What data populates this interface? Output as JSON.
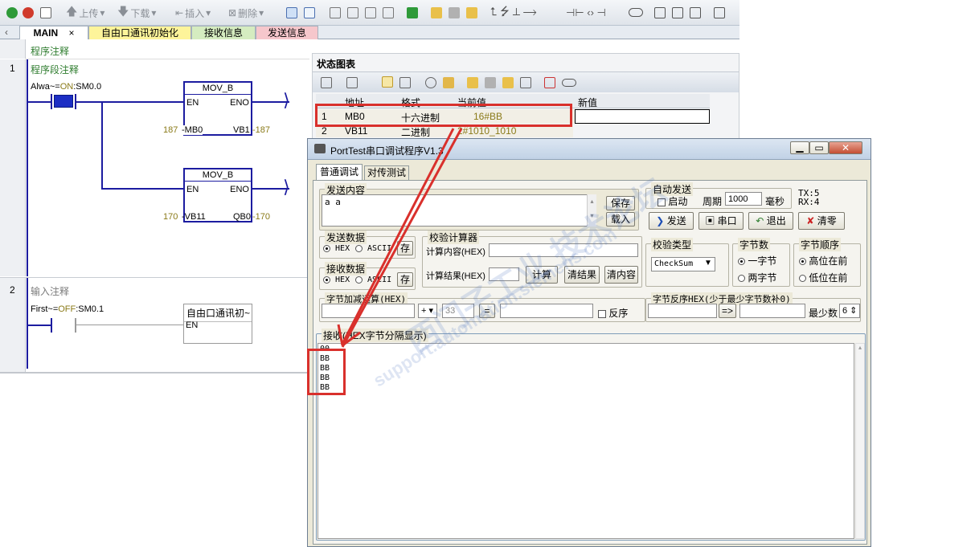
{
  "toolbar": {
    "upload": "上传",
    "download": "下载",
    "insert": "插入",
    "delete": "删除"
  },
  "tabs": [
    {
      "label": "MAIN",
      "close": "×"
    },
    {
      "label": "自由口通讯初始化"
    },
    {
      "label": "接收信息"
    },
    {
      "label": "发送信息"
    }
  ],
  "ladder": {
    "program_comment": "程序注释",
    "net1": {
      "num": "1",
      "comment": "程序段注释",
      "contact_sym": "Alwa~",
      "contact_eq": "=",
      "contact_state": "ON",
      "contact_addr": ":SM0.0",
      "box1": {
        "title": "MOV_B",
        "en": "EN",
        "eno": "ENO",
        "in_val": "187",
        "in": "MB0",
        "out": "VB1",
        "out_val": "187"
      },
      "box2": {
        "title": "MOV_B",
        "en": "EN",
        "eno": "ENO",
        "in_val": "170",
        "in": "VB11",
        "out": "QB0",
        "out_val": "170"
      }
    },
    "net2": {
      "num": "2",
      "comment": "输入注释",
      "contact_sym": "First~",
      "contact_eq": "=",
      "contact_state": "OFF",
      "contact_addr": ":SM0.1",
      "box_title": "自由口通讯初~",
      "en": "EN"
    }
  },
  "status_chart": {
    "title": "状态图表",
    "columns": [
      "",
      "地址",
      "格式",
      "当前值",
      "新值"
    ],
    "rows": [
      {
        "n": "1",
        "addr": "MB0",
        "fmt": "十六进制",
        "val": "16#BB",
        "new": ""
      },
      {
        "n": "2",
        "addr": "VB11",
        "fmt": "二进制",
        "val": "2#1010_1010",
        "new": ""
      }
    ]
  },
  "porttest": {
    "title": "PortTest串口调试程序V1.3",
    "tabs": [
      "普通调试",
      "对传测试"
    ],
    "send_content_label": "发送内容",
    "send_text": "a a",
    "save_btn": "保存",
    "load_btn": "载入",
    "auto_send_label": "自动发送",
    "start_label": "启动",
    "period_label": "周期",
    "period_value": "1000",
    "ms_label": "毫秒",
    "tx": "TX:5",
    "rx": "RX:4",
    "send_btn": "发送",
    "port_btn": "串口",
    "exit_btn": "退出",
    "clear_btn": "清零",
    "send_data_label": "发送数据",
    "hex": "HEX",
    "ascii": "ASCII",
    "store": "存",
    "recv_data_label": "接收数据",
    "calc_label": "校验计算器",
    "calc_content": "计算内容(HEX)",
    "calc_result": "计算结果(HEX)",
    "calc_btn": "计算",
    "clear_result_btn": "清结果",
    "clear_content_btn": "清内容",
    "check_type_label": "校验类型",
    "check_type_value": "CheckSum",
    "byte_count_label": "字节数",
    "one_byte": "一字节",
    "two_byte": "两字节",
    "byte_order_label": "字节顺序",
    "high_first": "高位在前",
    "low_first": "低位在前",
    "byte_add_label": "字节加减运算(HEX)",
    "op": "+",
    "op_value": "33",
    "eq": "=",
    "reverse": "反序",
    "byte_rev_label": "字节反序HEX(少于最少字节数补0)",
    "arrow": "=>",
    "min_label": "最少数",
    "min_value": "6",
    "recv_label": "接收(HEX字节分隔显示)",
    "recv_lines": [
      "00",
      "BB",
      "BB",
      "BB",
      "BB"
    ]
  },
  "watermark": {
    "line1": "西门子工业 技术论坛",
    "line2": "support.automation.siemens.com"
  },
  "colors": {
    "annotation_red": "#d9302c",
    "ladder_blue": "#1c1ca0",
    "tab_yellow": "#fdf49a",
    "tab_green": "#d5ecc0",
    "tab_pink": "#f6c7cc"
  }
}
